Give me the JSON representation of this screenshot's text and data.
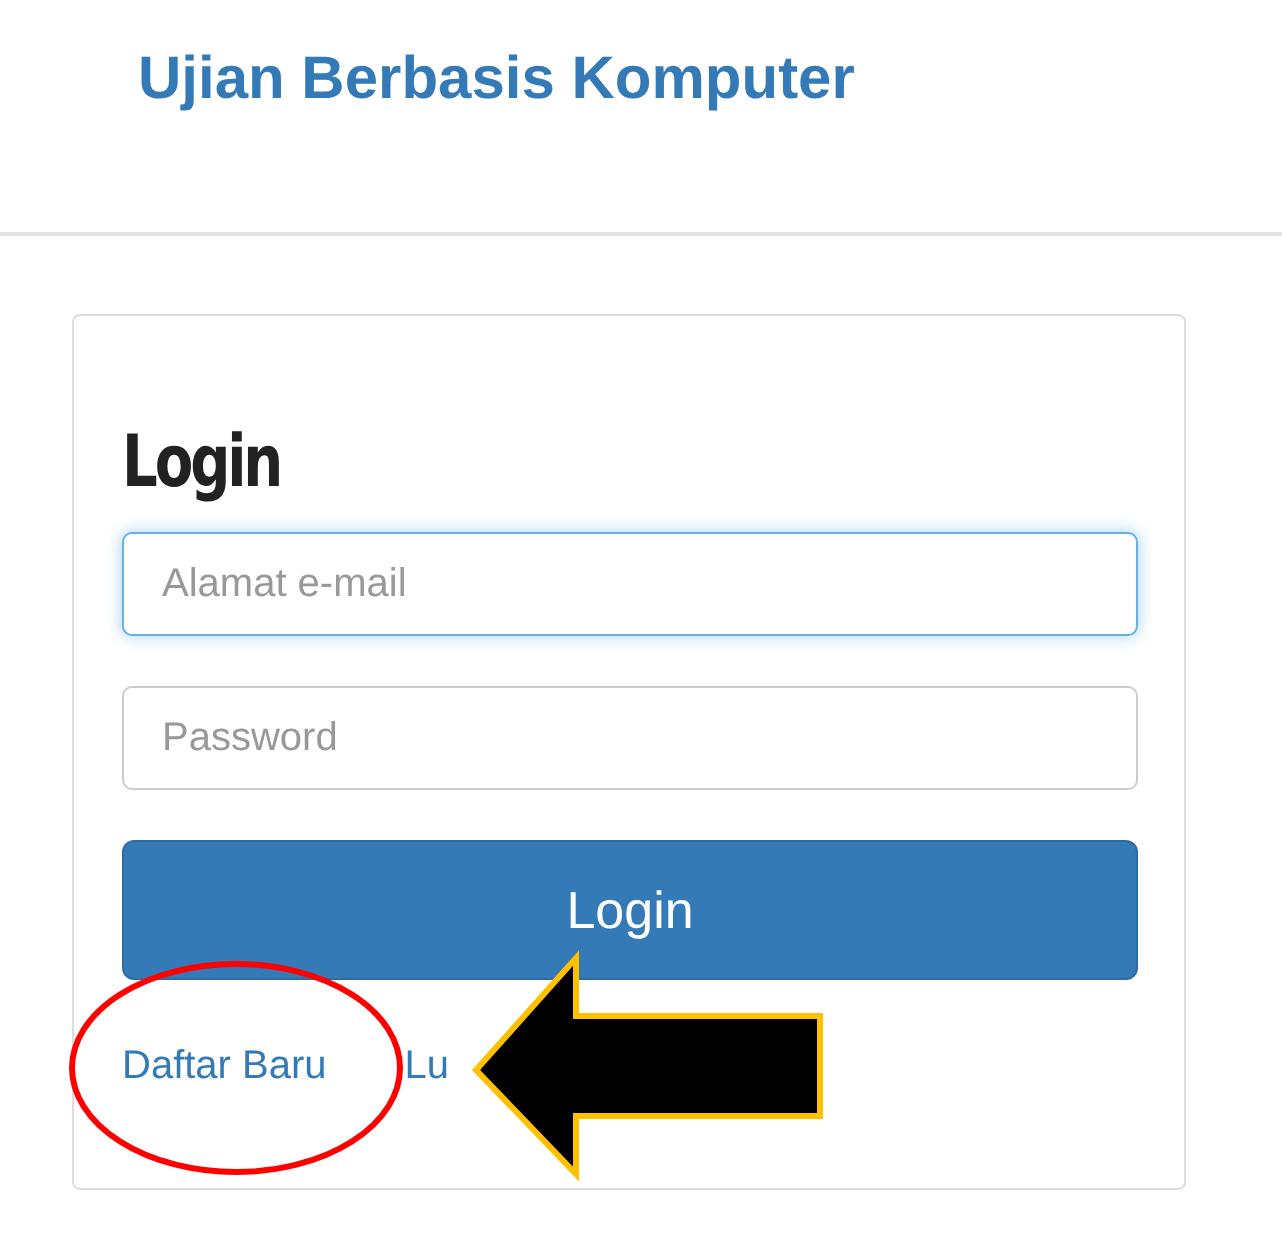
{
  "header": {
    "title": "Ujian Berbasis Komputer"
  },
  "login_form": {
    "heading": "Login",
    "fields": [
      {
        "placeholder": "Alamat e-mail",
        "focused": true
      },
      {
        "placeholder": "Password",
        "focused": false
      }
    ],
    "button": "Login",
    "links": [
      "Daftar Baru",
      "Lu"
    ]
  }
}
